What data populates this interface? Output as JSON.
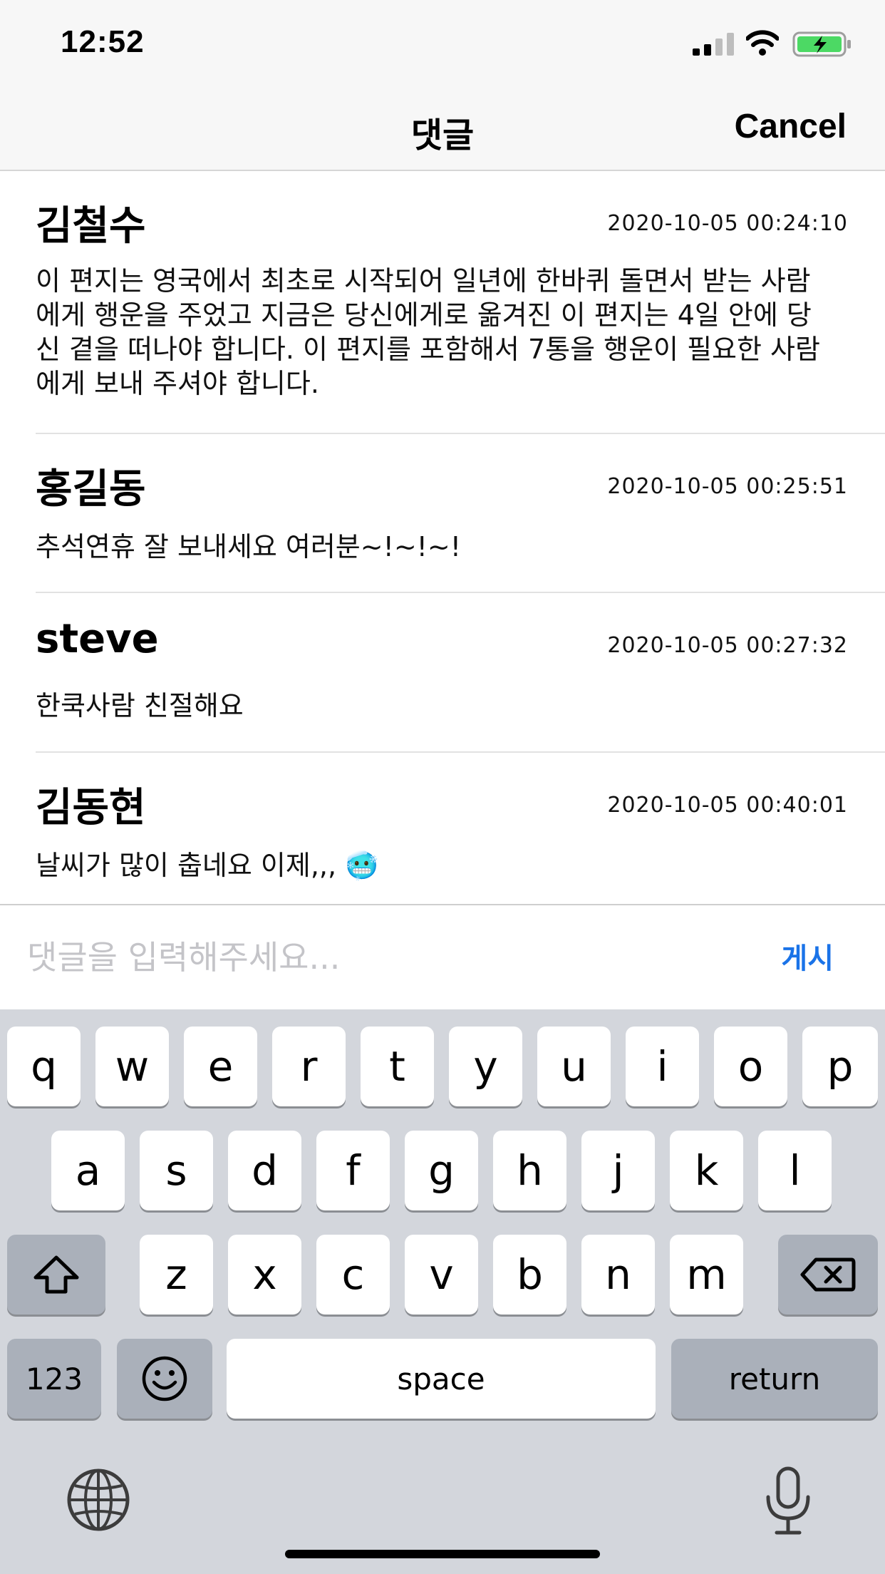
{
  "status_bar": {
    "time": "12:52"
  },
  "nav": {
    "title": "댓글",
    "cancel_label": "Cancel"
  },
  "comments": [
    {
      "author": "김철수",
      "timestamp": "2020-10-05 00:24:10",
      "text": "이 편지는 영국에서 최초로 시작되어 일년에 한바퀴 돌면서 받는 사람에게 행운을 주었고 지금은 당신에게로 옮겨진 이 편지는 4일 안에 당신 곁을 떠나야 합니다. 이 편지를 포함해서 7통을 행운이 필요한 사람에게 보내 주셔야 합니다."
    },
    {
      "author": "홍길동",
      "timestamp": "2020-10-05 00:25:51",
      "text": "추석연휴 잘 보내세요 여러분~!~!~!"
    },
    {
      "author": "steve",
      "timestamp": "2020-10-05 00:27:32",
      "text": "한쿡사람 친절해요"
    },
    {
      "author": "김동현",
      "timestamp": "2020-10-05 00:40:01",
      "text": "날씨가 많이 춥네요 이제,,, 🥶"
    }
  ],
  "input": {
    "placeholder": "댓글을 입력해주세요...",
    "value": "",
    "post_label": "게시"
  },
  "keyboard": {
    "row1": [
      "q",
      "w",
      "e",
      "r",
      "t",
      "y",
      "u",
      "i",
      "o",
      "p"
    ],
    "row2": [
      "a",
      "s",
      "d",
      "f",
      "g",
      "h",
      "j",
      "k",
      "l"
    ],
    "row3": [
      "z",
      "x",
      "c",
      "v",
      "b",
      "n",
      "m"
    ],
    "numbers_label": "123",
    "space_label": "space",
    "return_label": "return",
    "icons": [
      "shift-icon",
      "delete-icon",
      "emoji-icon",
      "globe-icon",
      "microphone-icon"
    ]
  },
  "colors": {
    "accent": "#1a73e8",
    "keyboard_bg": "#d3d6dc",
    "battery_green": "#4cd964"
  }
}
